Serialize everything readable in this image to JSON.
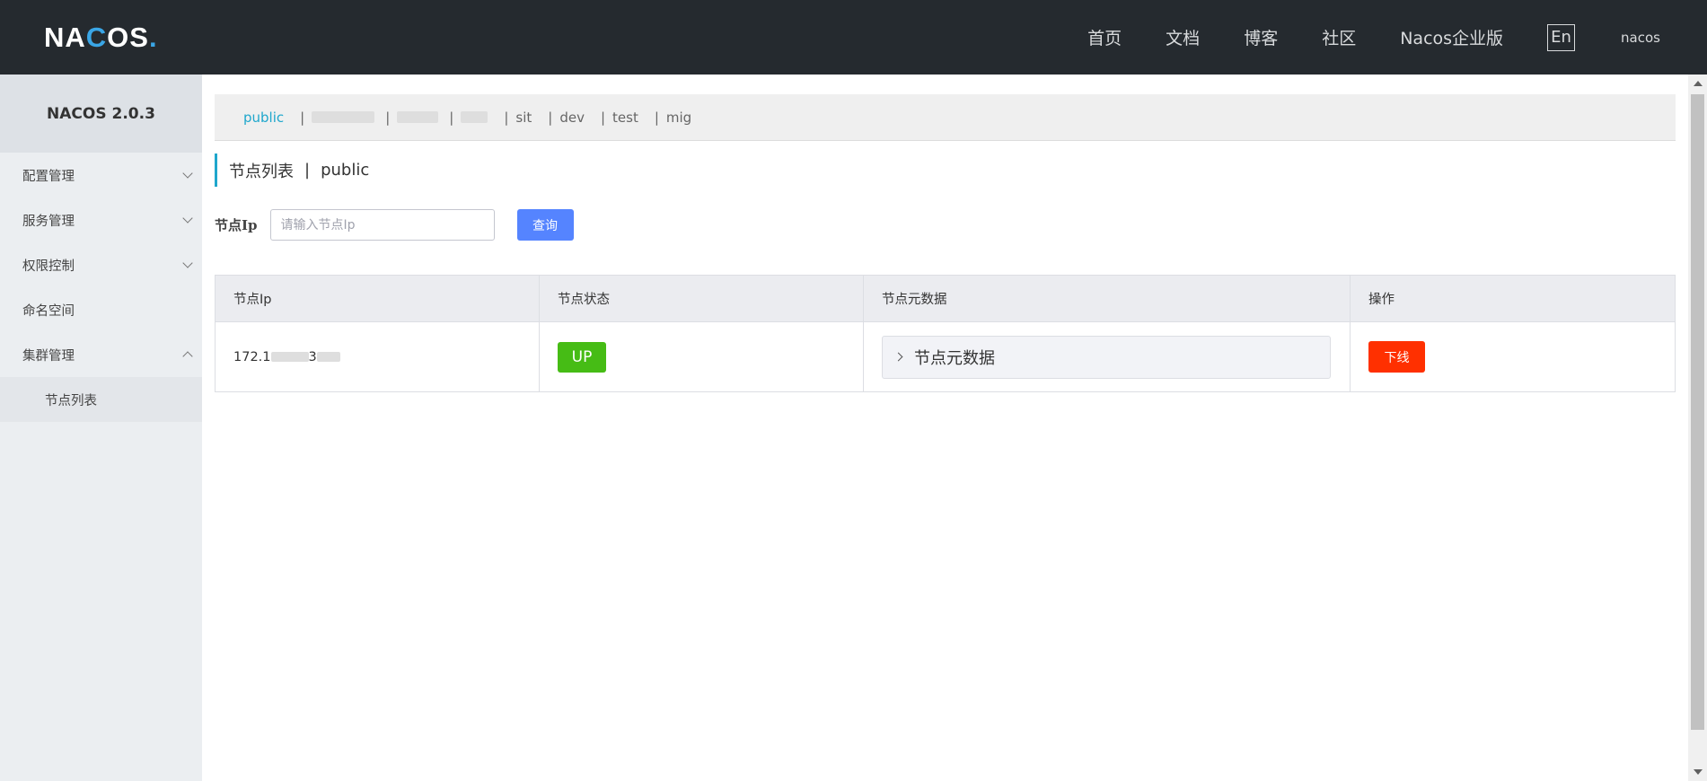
{
  "topbar": {
    "logo": {
      "pre": "NA",
      "c": "C",
      "post": "OS",
      "dot": "."
    },
    "nav": [
      "首页",
      "文档",
      "博客",
      "社区",
      "Nacos企业版"
    ],
    "lang": "En",
    "user": "nacos"
  },
  "sidebar": {
    "title": "NACOS 2.0.3",
    "items": [
      {
        "label": "配置管理"
      },
      {
        "label": "服务管理"
      },
      {
        "label": "权限控制"
      },
      {
        "label": "命名空间"
      },
      {
        "label": "集群管理"
      }
    ],
    "subitems": [
      {
        "label": "节点列表"
      }
    ]
  },
  "namespaces": {
    "active": "public",
    "items": [
      "public",
      "sit",
      "dev",
      "test",
      "mig"
    ]
  },
  "page": {
    "title": "节点列表",
    "namespace": "public"
  },
  "search": {
    "label": "节点Ip",
    "placeholder": "请输入节点Ip",
    "button": "查询"
  },
  "table": {
    "columns": [
      "节点Ip",
      "节点状态",
      "节点元数据",
      "操作"
    ],
    "rows": [
      {
        "ip_prefix": "172.1",
        "ip_mid": "3",
        "status": "UP",
        "meta": "节点元数据",
        "action": "下线"
      }
    ]
  },
  "colors": {
    "topbar": "#252a2f",
    "accent": "#1fa7cc",
    "primary_button": "#5584ff",
    "status_up": "#46bc15",
    "danger": "#ff3000"
  }
}
